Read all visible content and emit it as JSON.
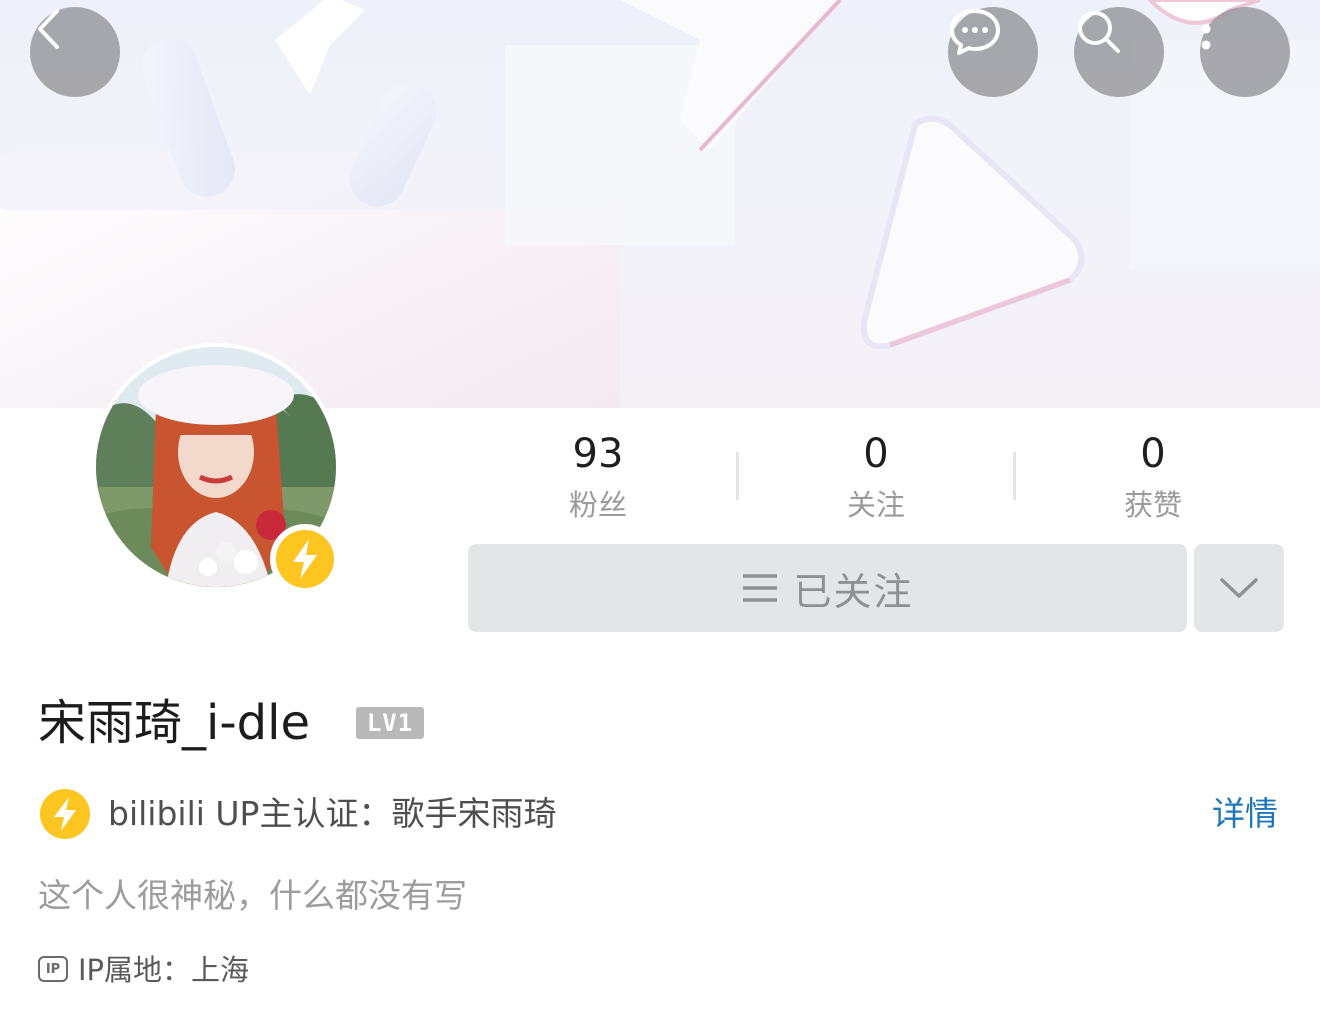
{
  "profile": {
    "username": "宋雨琦_i-dle",
    "level": "LV1",
    "stats": {
      "fans_value": "93",
      "fans_label": "粉丝",
      "following_value": "0",
      "following_label": "关注",
      "likes_value": "0",
      "likes_label": "获赞"
    },
    "follow_button_label": "已关注",
    "certification": "bilibili UP主认证：歌手宋雨琦",
    "detail_link": "详情",
    "bio": "这个人很神秘，什么都没有写",
    "ip_icon_text": "IP",
    "ip_location": "IP属地：上海"
  },
  "colors": {
    "accent_link": "#1e76b8",
    "verify_yellow": "#fdc51f",
    "button_bg": "#e4e5e7"
  },
  "icons": {
    "back": "chevron-left-icon",
    "chat": "chat-bubble-icon",
    "search": "search-icon",
    "more": "more-vertical-icon",
    "verify": "lightning-icon",
    "follow": "menu-lines-icon",
    "dropdown": "chevron-down-icon",
    "ip": "ip-icon"
  }
}
